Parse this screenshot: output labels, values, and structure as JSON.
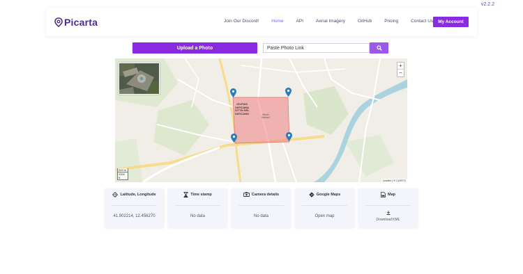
{
  "version": "v2.2.2",
  "brand": {
    "name": "Picarta"
  },
  "nav": {
    "links": [
      "Join Our Discord!",
      "Home",
      "API",
      "Aerial Imagery",
      "GitHub",
      "Pricing",
      "Contact Us"
    ],
    "active": "Home",
    "account_label": "My Account"
  },
  "upload": {
    "button_label": "Upload a Photo"
  },
  "search": {
    "placeholder": "Paste Photo Link"
  },
  "map": {
    "label_main": "CIVITAS VATICANA CITTÀ DEL VATICANO",
    "label_secondary": "Musei Vaticani",
    "scale_m": "200 m",
    "scale_ft": "1000 ft",
    "attribution": "Leaflet | © CARTO",
    "zoom_in": "+",
    "zoom_out": "−"
  },
  "cards": {
    "coords": {
      "title": "Latitude, Longitude",
      "value": "41.902214, 12.456270",
      "icon": "crosshair-icon"
    },
    "time": {
      "title": "Time stamp",
      "value": "No data",
      "icon": "hourglass-icon"
    },
    "camera": {
      "title": "Camera details",
      "value": "No data",
      "icon": "camera-icon"
    },
    "gmaps": {
      "title": "Google Maps",
      "value": "Open map",
      "icon": "directions-icon"
    },
    "map": {
      "title": "Map",
      "value": "Download KML",
      "icon": "download-icon"
    }
  },
  "colors": {
    "accent": "#8a2be2",
    "brand": "#4a2c8c",
    "polygon_fill": "#f08a8a",
    "marker": "#2a7dbb"
  }
}
